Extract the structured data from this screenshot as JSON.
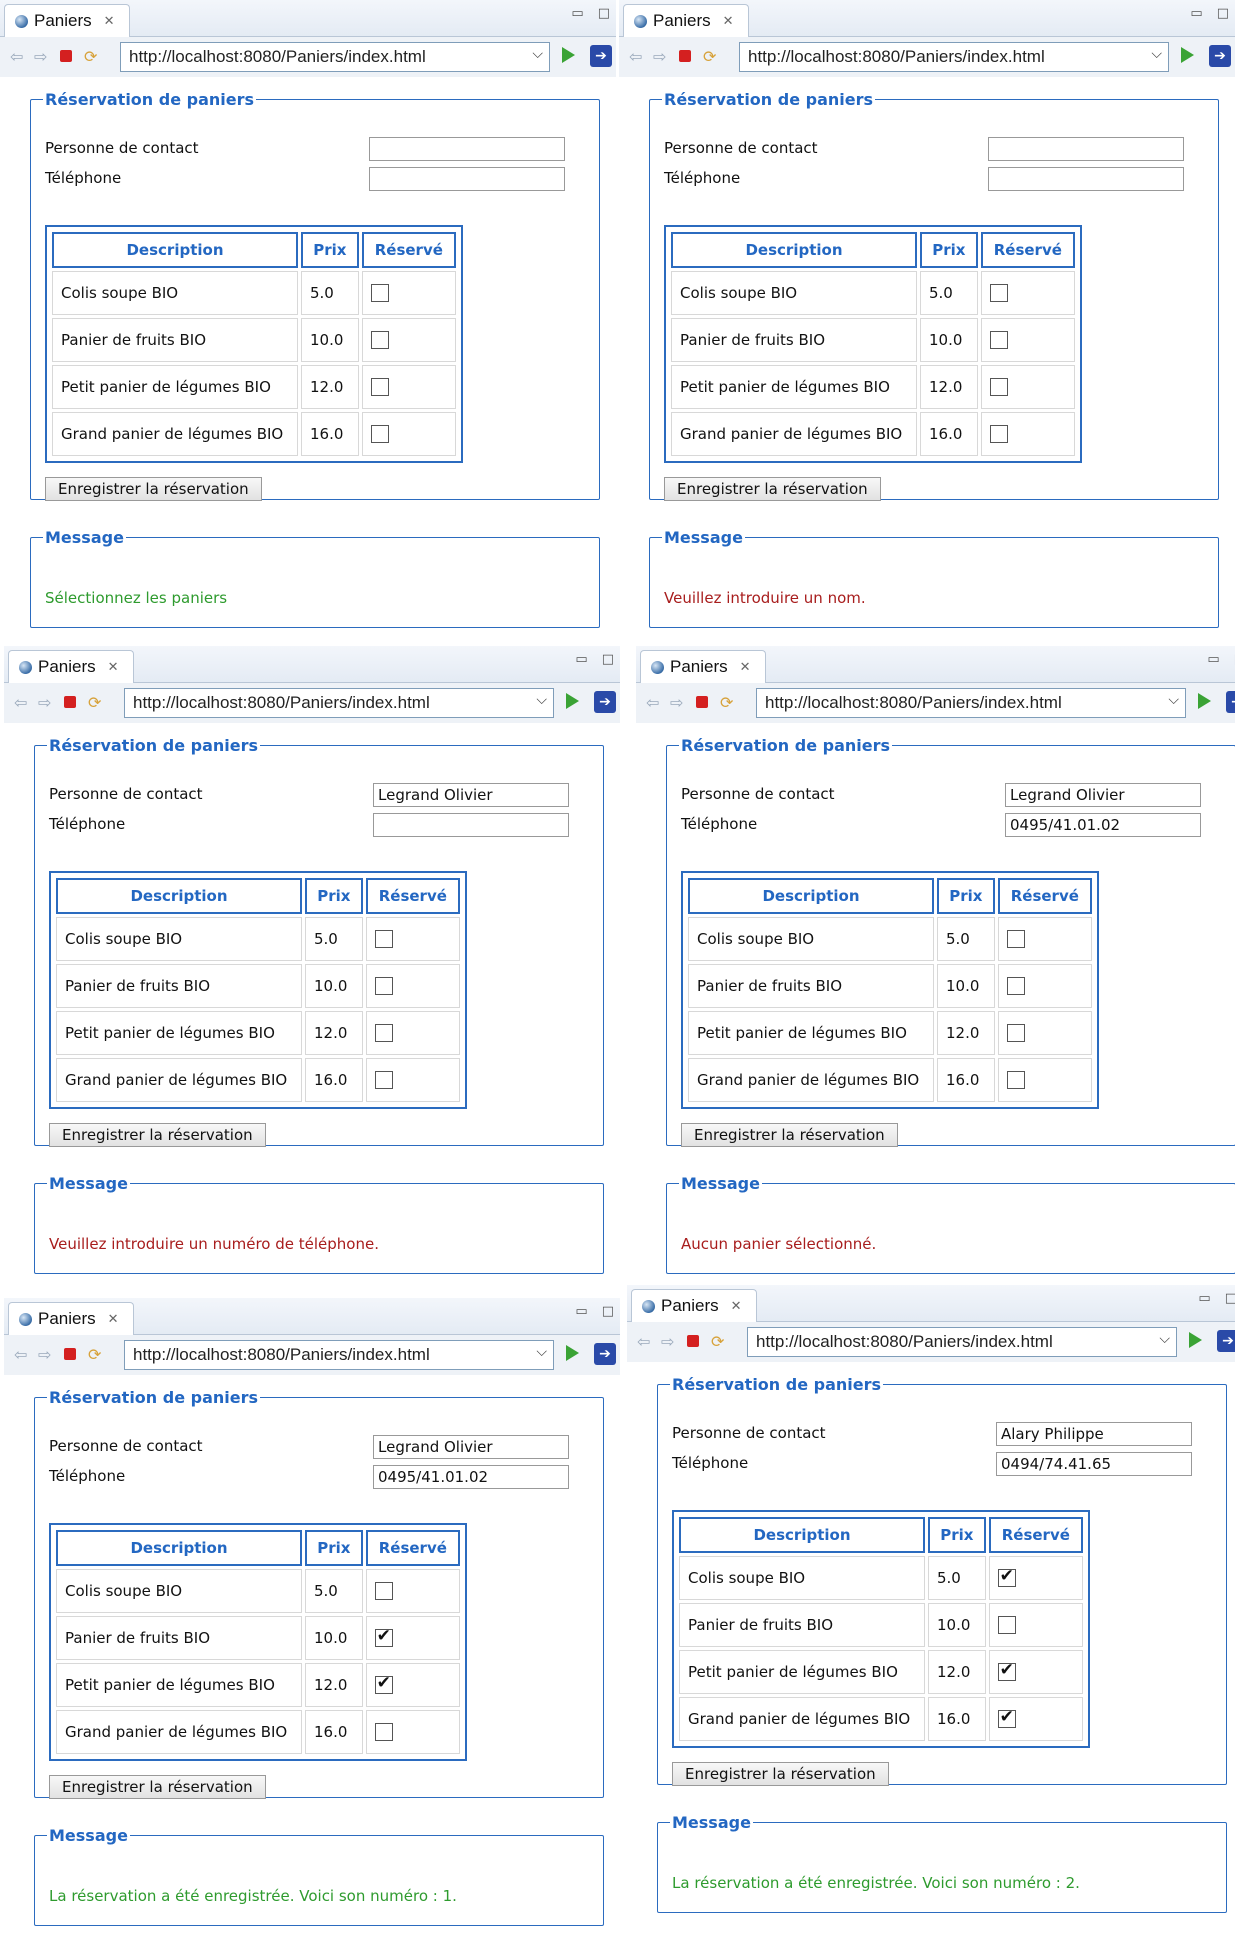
{
  "tab_title": "Paniers",
  "url": "http://localhost:8080/Paniers/index.html",
  "group_title": "Réservation de paniers",
  "contact_label": "Personne de contact",
  "phone_label": "Téléphone",
  "headers": {
    "description": "Description",
    "price": "Prix",
    "reserved": "Réservé"
  },
  "save_label": "Enregistrer la réservation",
  "message_title": "Message",
  "products": [
    {
      "description": "Colis soupe BIO",
      "price": "5.0"
    },
    {
      "description": "Panier de fruits BIO",
      "price": "10.0"
    },
    {
      "description": "Petit panier de légumes BIO",
      "price": "12.0"
    },
    {
      "description": "Grand panier de légumes BIO",
      "price": "16.0"
    }
  ],
  "colors": {
    "accent": "#2b6bbf",
    "ok": "#2e9b2e",
    "error": "#a81d1d"
  },
  "panels": [
    {
      "contact": "",
      "phone": "",
      "checked": [
        false,
        false,
        false,
        false
      ],
      "message": "Sélectionnez les paniers",
      "message_type": "ok"
    },
    {
      "contact": "",
      "phone": "",
      "checked": [
        false,
        false,
        false,
        false
      ],
      "message": "Veuillez introduire un nom.",
      "message_type": "err"
    },
    {
      "contact": "Legrand Olivier",
      "phone": "",
      "checked": [
        false,
        false,
        false,
        false
      ],
      "message": "Veuillez introduire un numéro de téléphone.",
      "message_type": "err"
    },
    {
      "contact": "Legrand Olivier",
      "phone": "0495/41.01.02",
      "checked": [
        false,
        false,
        false,
        false
      ],
      "message": "Aucun panier sélectionné.",
      "message_type": "err"
    },
    {
      "contact": "Legrand Olivier",
      "phone": "0495/41.01.02",
      "checked": [
        false,
        true,
        true,
        false
      ],
      "message": "La réservation a été enregistrée. Voici son numéro : 1.",
      "message_type": "ok"
    },
    {
      "contact": "Alary Philippe",
      "phone": "0494/74.41.65",
      "checked": [
        true,
        false,
        true,
        true
      ],
      "message": "La réservation a été enregistrée. Voici son numéro : 2.",
      "message_type": "ok"
    }
  ]
}
